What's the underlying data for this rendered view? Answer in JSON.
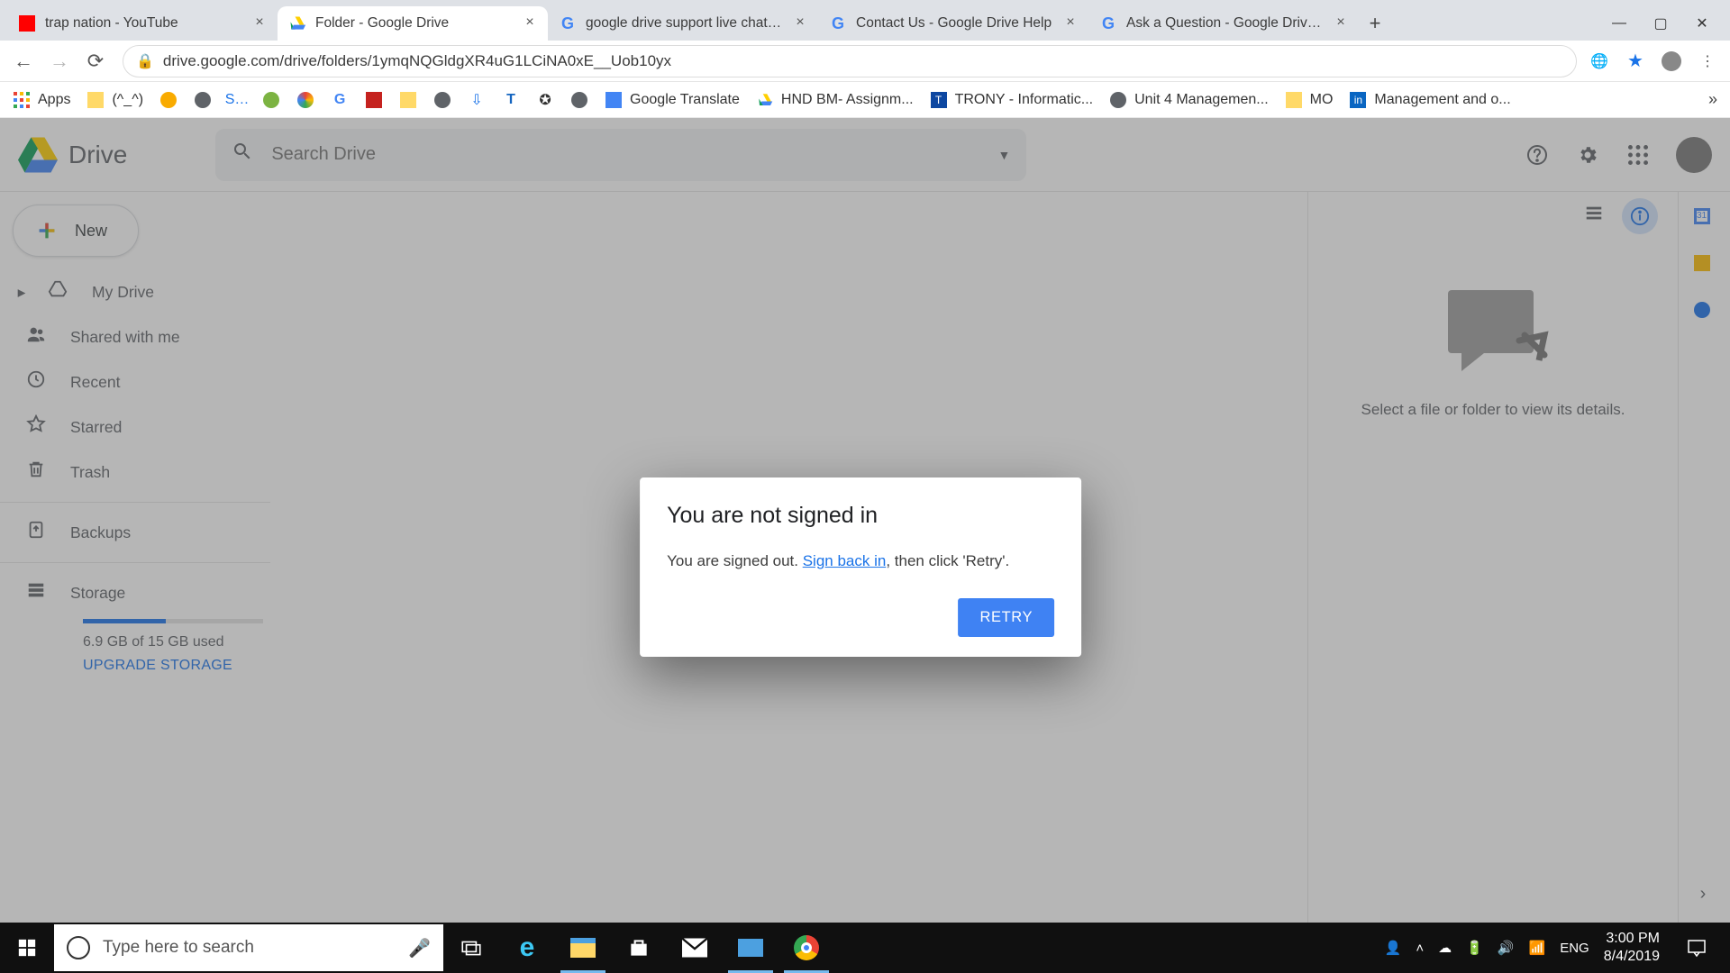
{
  "tabs": [
    {
      "title": "trap nation - YouTube",
      "active": false
    },
    {
      "title": "Folder - Google Drive",
      "active": true
    },
    {
      "title": "google drive support live chat - G",
      "active": false
    },
    {
      "title": "Contact Us - Google Drive Help",
      "active": false
    },
    {
      "title": "Ask a Question - Google Drive He",
      "active": false
    }
  ],
  "address": "drive.google.com/drive/folders/1ymqNQGldgXR4uG1LCiNA0xE__Uob10yx",
  "bookmarks": [
    {
      "label": "Apps"
    },
    {
      "label": "(^_^)"
    },
    {
      "label": ""
    },
    {
      "label": ""
    },
    {
      "label": ""
    },
    {
      "label": ""
    },
    {
      "label": ""
    },
    {
      "label": ""
    },
    {
      "label": ""
    },
    {
      "label": ""
    },
    {
      "label": ""
    },
    {
      "label": ""
    },
    {
      "label": ""
    },
    {
      "label": ""
    },
    {
      "label": ""
    },
    {
      "label": "Google Translate"
    },
    {
      "label": "HND BM- Assignm..."
    },
    {
      "label": "TRONY - Informatic..."
    },
    {
      "label": "Unit 4 Managemen..."
    },
    {
      "label": "MO"
    },
    {
      "label": "Management and o..."
    }
  ],
  "drive": {
    "brand": "Drive",
    "search_placeholder": "Search Drive",
    "new_label": "New",
    "nav": [
      "My Drive",
      "Shared with me",
      "Recent",
      "Starred",
      "Trash"
    ],
    "backups": "Backups",
    "storage_label": "Storage",
    "storage_used": "6.9 GB of 15 GB used",
    "upgrade": "UPGRADE STORAGE",
    "details_empty": "Select a file or folder to view its details."
  },
  "modal": {
    "title": "You are not signed in",
    "msg_before": "You are signed out. ",
    "link": "Sign back in",
    "msg_after": ", then click 'Retry'.",
    "retry": "RETRY"
  },
  "taskbar": {
    "search_placeholder": "Type here to search",
    "lang": "ENG",
    "time": "3:00 PM",
    "date": "8/4/2019"
  }
}
